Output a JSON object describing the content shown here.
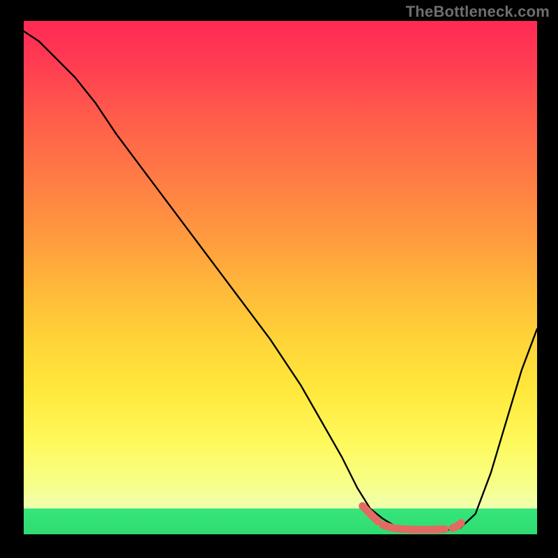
{
  "watermark": "TheBottleneck.com",
  "chart_data": {
    "type": "line",
    "title": "",
    "xlabel": "",
    "ylabel": "",
    "xlim": [
      0,
      100
    ],
    "ylim": [
      0,
      100
    ],
    "grid": false,
    "series": [
      {
        "name": "bottleneck-curve",
        "x": [
          0,
          3,
          6,
          10,
          14,
          18,
          24,
          30,
          36,
          42,
          48,
          54,
          58,
          62,
          65,
          67.5,
          70,
          72.5,
          75,
          78,
          81,
          83,
          85,
          88,
          91,
          94,
          97,
          100
        ],
        "values": [
          98,
          96,
          93,
          89,
          84,
          78,
          70,
          62,
          54,
          46,
          38,
          29,
          22,
          15,
          9,
          5,
          3,
          1.5,
          1,
          0.8,
          0.8,
          0.9,
          1.2,
          4,
          12,
          22,
          32,
          40
        ]
      }
    ],
    "markers": {
      "name": "highlight-segments",
      "color": "#e36a62",
      "points": [
        {
          "x": 66,
          "y": 5.5
        },
        {
          "x": 67.5,
          "y": 4
        },
        {
          "x": 69,
          "y": 2.5
        },
        {
          "x": 70,
          "y": 1.8
        },
        {
          "x": 72,
          "y": 1.2
        },
        {
          "x": 74,
          "y": 1.0
        },
        {
          "x": 76,
          "y": 0.9
        },
        {
          "x": 78,
          "y": 0.9
        },
        {
          "x": 80,
          "y": 0.9
        },
        {
          "x": 82,
          "y": 1.0
        },
        {
          "x": 83.5,
          "y": 1.2
        },
        {
          "x": 84.5,
          "y": 1.6
        },
        {
          "x": 85.2,
          "y": 2.2
        }
      ]
    }
  }
}
